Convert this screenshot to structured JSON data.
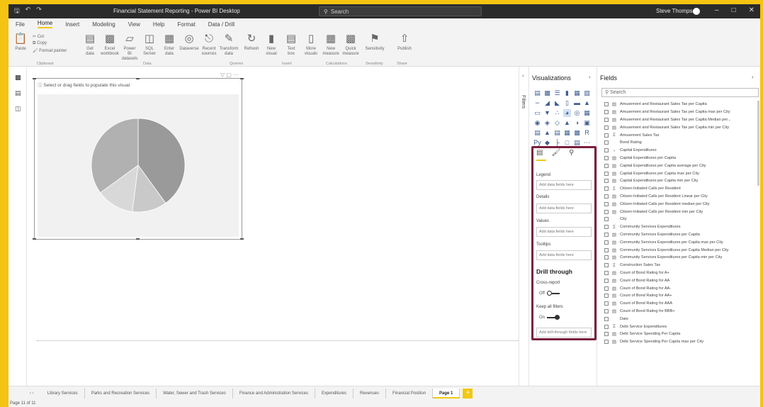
{
  "titlebar": {
    "title": "Financial Statement Reporting - Power BI Desktop",
    "search_placeholder": "Search",
    "user": "Steve Thompson"
  },
  "menu": [
    "File",
    "Home",
    "Insert",
    "Modeling",
    "View",
    "Help",
    "Format",
    "Data / Drill"
  ],
  "ribbon": {
    "clipboard": {
      "paste": "Paste",
      "cut": "Cut",
      "copy": "Copy",
      "format_painter": "Format painter",
      "label": "Clipboard"
    },
    "data": {
      "buttons": [
        "Get data",
        "Excel workbook",
        "Power BI datasets",
        "SQL Server",
        "Enter data",
        "Dataverse",
        "Recent sources"
      ],
      "label": "Data"
    },
    "queries": {
      "buttons": [
        "Transform data",
        "Refresh"
      ],
      "label": "Queries"
    },
    "insert": {
      "buttons": [
        "New visual",
        "Text box",
        "More visuals"
      ],
      "label": "Insert"
    },
    "calculations": {
      "buttons": [
        "New measure",
        "Quick measure"
      ],
      "label": "Calculations"
    },
    "sensitivity": {
      "buttons": [
        "Sensitivity"
      ],
      "label": "Sensitivity"
    },
    "share": {
      "buttons": [
        "Publish"
      ],
      "label": "Share"
    }
  },
  "visual": {
    "header": "Select or drag fields to populate this visual"
  },
  "chart_data": {
    "type": "pie",
    "values": [
      40,
      12,
      13,
      35
    ],
    "colors": [
      "#9a9a9a",
      "#c9c9c9",
      "#d8d8d8",
      "#b1b1b1"
    ]
  },
  "pages": [
    "Library Services",
    "Parks and Recreation Services",
    "Water, Sewer and Trash Services",
    "Finance and Administration Services",
    "Expenditures",
    "Revenues",
    "Financial Position",
    "Page 1"
  ],
  "status": "Page 11 of 11",
  "filters_label": "Filters",
  "visualizations": {
    "title": "Visualizations",
    "wells": [
      {
        "label": "Legend",
        "placeholder": "Add data fields here"
      },
      {
        "label": "Details",
        "placeholder": "Add data fields here"
      },
      {
        "label": "Values",
        "placeholder": "Add data fields here"
      },
      {
        "label": "Tooltips",
        "placeholder": "Add data fields here"
      }
    ],
    "drill_title": "Drill through",
    "cross_report": {
      "label": "Cross-report",
      "state": "Off"
    },
    "keep_filters": {
      "label": "Keep all filters",
      "state": "On"
    },
    "drill_placeholder": "Add drill-through fields here"
  },
  "fields": {
    "title": "Fields",
    "search_placeholder": "Search",
    "items": [
      {
        "name": "Amusement and Restaurant Sales Tax per Capita",
        "type": "calc"
      },
      {
        "name": "Amusement and Restaurant Sales Tax per Capita max per City",
        "type": "calc"
      },
      {
        "name": "Amusement and Restaurant Sales Tax per Capita Median per...",
        "type": "calc"
      },
      {
        "name": "Amusement and Restaurant Sales Tax per Capita min per City",
        "type": "calc"
      },
      {
        "name": "Amusement Sales Tax",
        "type": "sigma"
      },
      {
        "name": "Bond Rating",
        "type": "none"
      },
      {
        "name": "Capital Expenditures",
        "type": "expand"
      },
      {
        "name": "Capital Expenditures per Capita",
        "type": "calc"
      },
      {
        "name": "Capital Expenditures per Capita average per City",
        "type": "calc"
      },
      {
        "name": "Capital Expenditures per Capita max per City",
        "type": "calc"
      },
      {
        "name": "Capital Expenditures per Capita min per City",
        "type": "calc"
      },
      {
        "name": "Citizen-Initiated Calls per Resident",
        "type": "sigma"
      },
      {
        "name": "Citizen-Initiated Calls per Resident Linear per City",
        "type": "calc"
      },
      {
        "name": "Citizen-Initiated Calls per Resident median per City",
        "type": "calc"
      },
      {
        "name": "Citizen-Initiated Calls per Resident min per City",
        "type": "calc"
      },
      {
        "name": "City",
        "type": "none"
      },
      {
        "name": "Community Services Expenditures",
        "type": "sigma"
      },
      {
        "name": "Community Services Expenditures per Capita",
        "type": "calc"
      },
      {
        "name": "Community Services Expenditures per Capita max per City",
        "type": "calc"
      },
      {
        "name": "Community Services Expenditures per Capita Median per City",
        "type": "calc"
      },
      {
        "name": "Community Services Expenditures per Capita min per City",
        "type": "calc"
      },
      {
        "name": "Construction Sales Tax",
        "type": "sigma"
      },
      {
        "name": "Count of Bond Rating for A+",
        "type": "calc"
      },
      {
        "name": "Count of Bond Rating for AA",
        "type": "calc"
      },
      {
        "name": "Count of Bond Rating for AA-",
        "type": "calc"
      },
      {
        "name": "Count of Bond Rating for AA+",
        "type": "calc"
      },
      {
        "name": "Count of Bond Rating for AAA",
        "type": "calc"
      },
      {
        "name": "Count of Bond Rating for BBB+",
        "type": "calc"
      },
      {
        "name": "Date",
        "type": "none"
      },
      {
        "name": "Debt Service Expenditures",
        "type": "sigma"
      },
      {
        "name": "Debt Service Spending Per Capita",
        "type": "calc"
      },
      {
        "name": "Debt Service Spending Per Capita max per City",
        "type": "calc"
      }
    ]
  }
}
